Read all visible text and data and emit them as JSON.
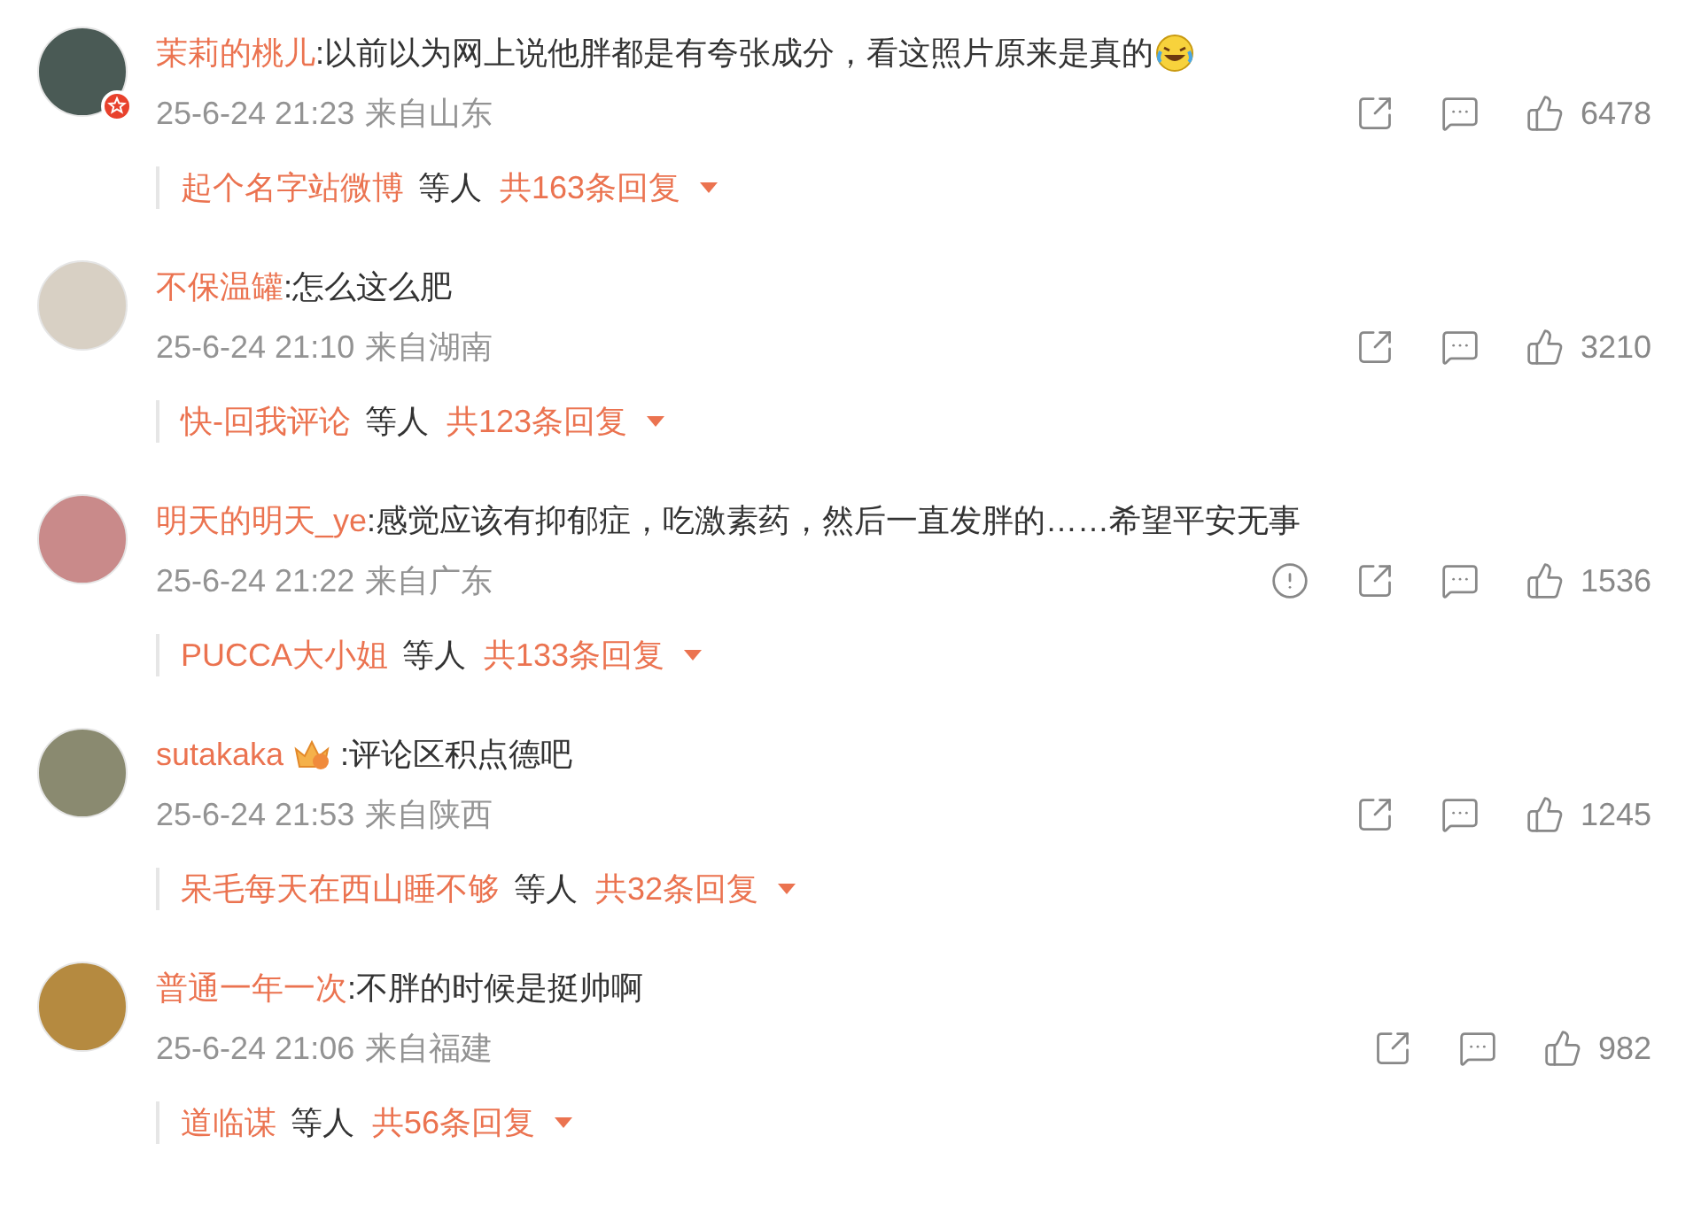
{
  "comments": [
    {
      "name": "茉莉的桃儿",
      "avatar_badge": true,
      "text": ":以前以为网上说他胖都是有夸张成分，看这照片原来是真的",
      "emoji": true,
      "time": "25-6-24 21:23",
      "location": "来自山东",
      "likes": "6478",
      "reply_user": "起个名字站微博",
      "reply_suffix": "等人",
      "reply_count": "共163条回复"
    },
    {
      "name": "不保温罐",
      "text": ":怎么这么肥",
      "time": "25-6-24 21:10",
      "location": "来自湖南",
      "likes": "3210",
      "reply_user": "快-回我评论",
      "reply_suffix": "等人",
      "reply_count": "共123条回复"
    },
    {
      "name": "明天的明天_ye",
      "text": ":感觉应该有抑郁症，吃激素药，然后一直发胖的……希望平安无事",
      "time": "25-6-24 21:22",
      "location": "来自广东",
      "report": true,
      "likes": "1536",
      "reply_user": "PUCCA大小姐",
      "reply_suffix": "等人",
      "reply_count": "共133条回复"
    },
    {
      "name": "sutakaka",
      "name_badge": true,
      "text": ":评论区积点德吧",
      "time": "25-6-24 21:53",
      "location": "来自陕西",
      "likes": "1245",
      "reply_user": "呆毛每天在西山睡不够",
      "reply_suffix": "等人",
      "reply_count": "共32条回复"
    },
    {
      "name": "普通一年一次",
      "text": ":不胖的时候是挺帅啊",
      "time": "25-6-24 21:06",
      "location": "来自福建",
      "likes": "982",
      "reply_user": "道临谋",
      "reply_suffix": "等人",
      "reply_count": "共56条回复"
    }
  ]
}
